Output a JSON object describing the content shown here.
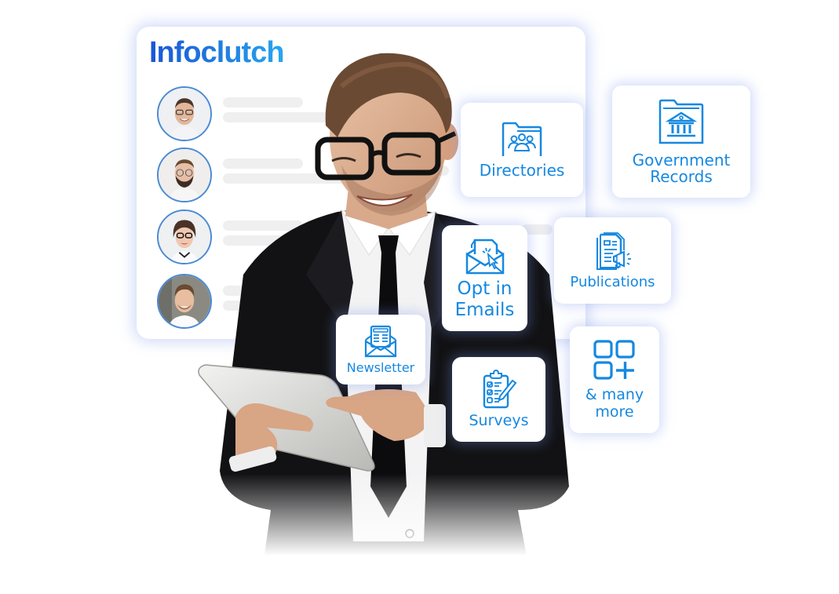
{
  "brand": {
    "logo_text": "Infoclutch",
    "primary_color": "#1688e0",
    "logo_gradient": [
      "#1a56d6",
      "#29a6ef"
    ]
  },
  "profile_card": {
    "profiles": [
      {
        "avatar": "man-with-glasses-smiling-avatar"
      },
      {
        "avatar": "bearded-man-with-glasses-avatar"
      },
      {
        "avatar": "woman-with-glasses-avatar"
      },
      {
        "avatar": "young-man-smiling-avatar"
      }
    ]
  },
  "hero_image": {
    "subject": "businessman-with-glasses-using-tablet"
  },
  "tiles": [
    {
      "id": "directories",
      "label": "Directories",
      "icon": "folder-people-icon"
    },
    {
      "id": "government-records",
      "label_line1": "Government",
      "label_line2": "Records",
      "icon": "folder-government-building-icon"
    },
    {
      "id": "opt-in-emails",
      "label_line1": "Opt in",
      "label_line2": "Emails",
      "icon": "envelope-click-icon"
    },
    {
      "id": "publications",
      "label": "Publications",
      "icon": "document-megaphone-icon"
    },
    {
      "id": "newsletter",
      "label": "Newsletter",
      "icon": "newsletter-envelope-icon"
    },
    {
      "id": "surveys",
      "label": "Surveys",
      "icon": "clipboard-checklist-icon"
    },
    {
      "id": "many-more",
      "label_line1": "& many",
      "label_line2": "more",
      "icon": "grid-plus-icon"
    }
  ]
}
